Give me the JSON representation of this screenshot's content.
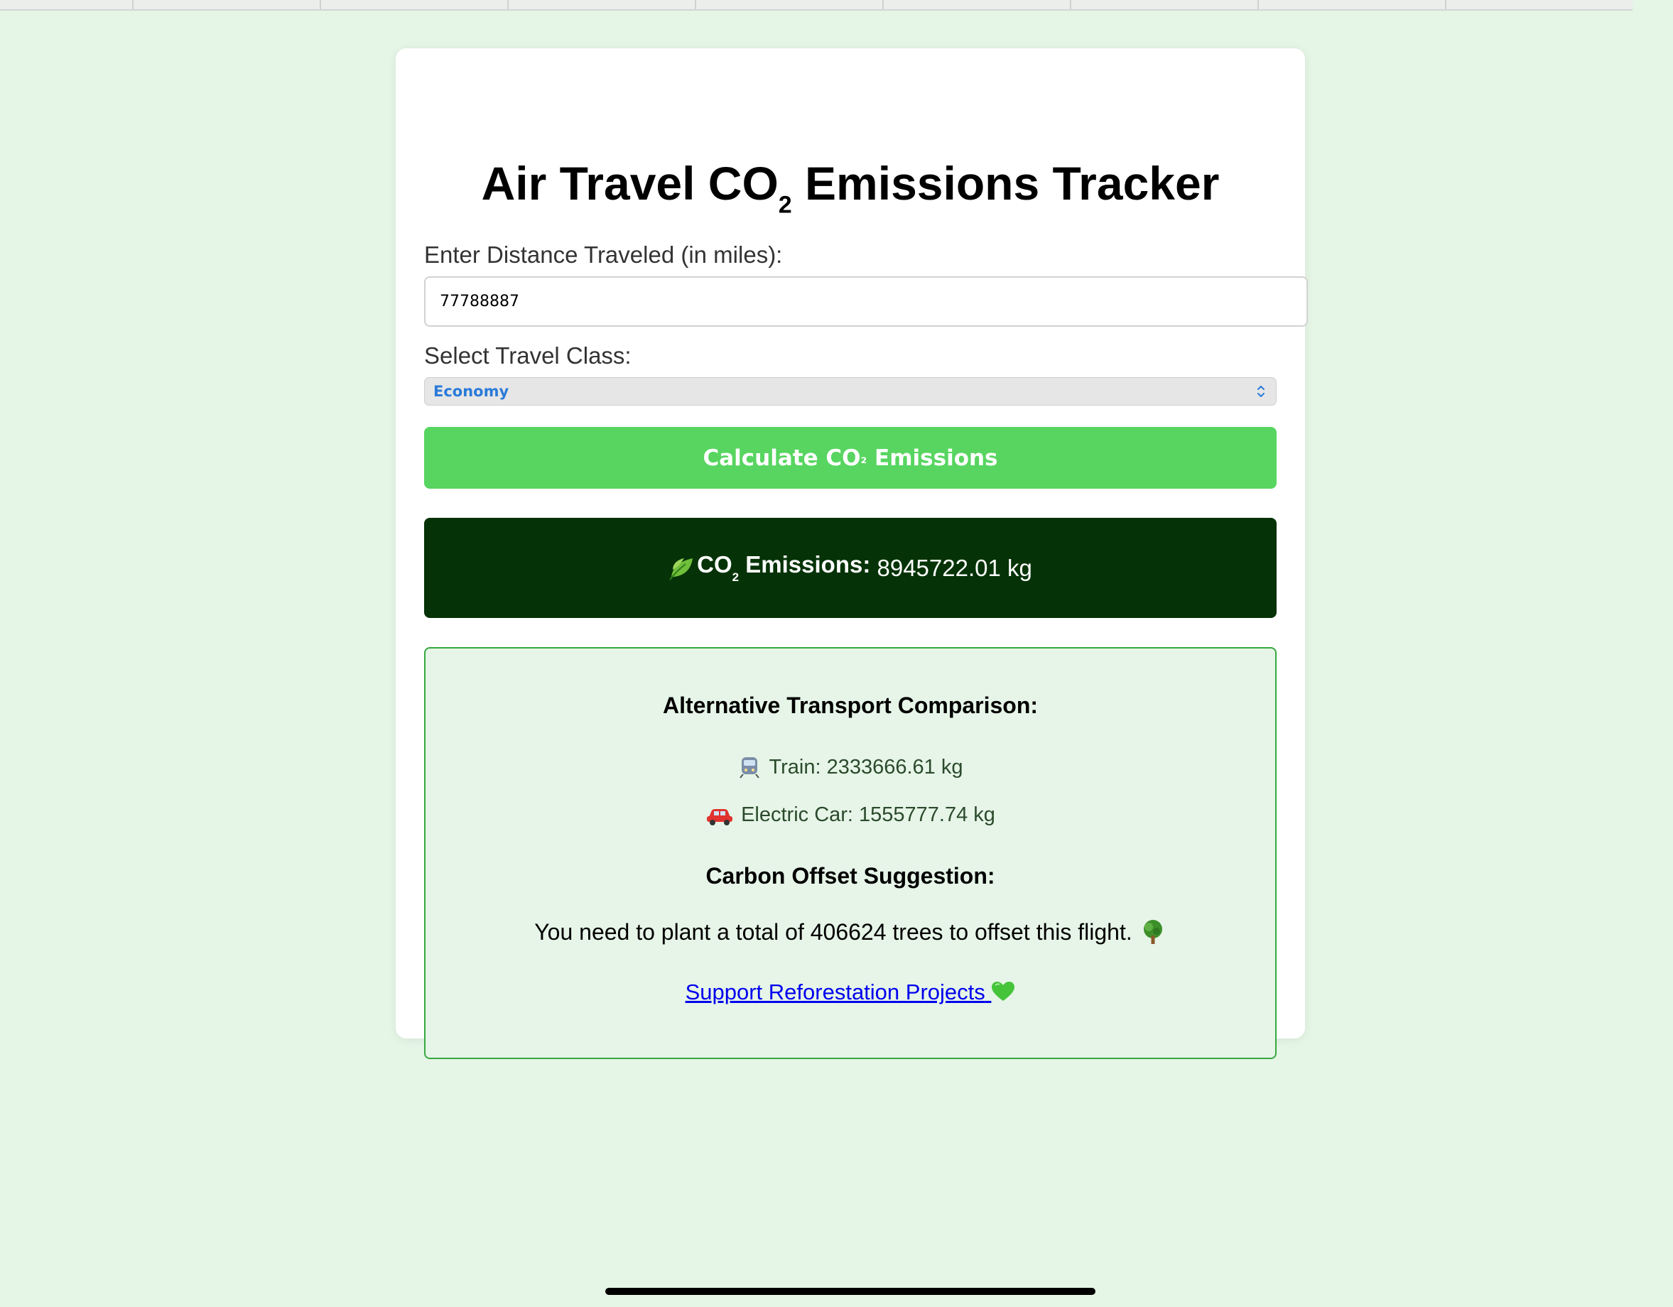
{
  "page": {
    "title_prefix": "Air Travel CO",
    "title_sub": "2",
    "title_suffix": " Emissions Tracker"
  },
  "form": {
    "distance_label": "Enter Distance Traveled (in miles):",
    "distance_value": "77788887",
    "class_label": "Select Travel Class:",
    "class_selected": "Economy",
    "calculate_prefix": "Calculate CO",
    "calculate_sub": "₂",
    "calculate_suffix": " Emissions"
  },
  "result": {
    "label_prefix": "CO",
    "label_sub": "2",
    "label_suffix": " Emissions:",
    "value": " 8945722.01 kg"
  },
  "comparison": {
    "heading": "Alternative Transport Comparison:",
    "train": "Train: 2333666.61 kg",
    "car": "Electric Car: 1555777.74 kg",
    "offset_heading": "Carbon Offset Suggestion:",
    "offset_text": "You need to plant a total of 406624 trees to offset this flight.",
    "link_text": "Support Reforestation Projects"
  },
  "icons": {
    "leaf": "leaf-icon",
    "train": "train-icon",
    "car": "car-icon",
    "tree": "tree-icon",
    "heart": "green-heart-icon",
    "chevron": "select-chevron-icon"
  },
  "colors": {
    "page_bg": "#e5f5e6",
    "button_green": "#57d560",
    "result_dark": "#053307",
    "panel_border": "#36a83e",
    "link_blue": "#0000ee"
  }
}
